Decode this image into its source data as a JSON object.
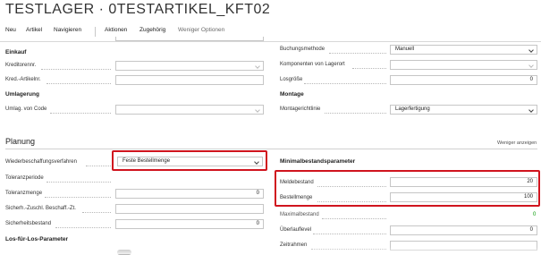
{
  "title": "TESTLAGER · 0TESTARTIKEL_KFT02",
  "menu": {
    "items": [
      "Neu",
      "Artikel",
      "Navigieren",
      "Aktionen",
      "Zugehörig",
      "Weniger Optionen"
    ]
  },
  "left_top": {
    "einkauf_heading": "Einkauf",
    "kreditorennr_label": "Kreditorennr.",
    "kreditorennr_value": "",
    "kred_artikelnr_label": "Kred.-Artikelnr.",
    "kred_artikelnr_value": "",
    "umlagerung_heading": "Umlagerung",
    "umlag_von_code_label": "Umlag. von Code",
    "umlag_von_code_value": ""
  },
  "right_top": {
    "buchungsmethode_label": "Buchungsmethode",
    "buchungsmethode_value": "Manuell",
    "komponenten_label": "Komponenten von Lagerort",
    "komponenten_value": "",
    "losgroesse_label": "Losgröße",
    "losgroesse_value": "0",
    "montage_heading": "Montage",
    "montagerichtlinie_label": "Montagerichtlinie",
    "montagerichtlinie_value": "Lagerfertigung"
  },
  "planung": {
    "title": "Planung",
    "show_less_link": "Weniger anzeigen",
    "wiederbeschaffung_label": "Wiederbeschaffungsverfahren",
    "wiederbeschaffung_value": "Feste Bestellmenge",
    "toleranzperiode_label": "Toleranzperiode",
    "toleranzmenge_label": "Toleranzmenge",
    "toleranzmenge_value": "0",
    "sicherh_zuschl_label": "Sicherh.-Zuschl. Beschaff.-Zt.",
    "sicherheitsbestand_label": "Sicherheitsbestand",
    "sicherheitsbestand_value": "0",
    "los_heading": "Los-für-Los-Parameter",
    "minimal_heading": "Minimalbestandsparameter",
    "meldebestand_label": "Meldebestand",
    "meldebestand_value": "20",
    "bestellmenge_label": "Bestellmenge",
    "bestellmenge_value": "100",
    "maximalbestand_label": "Maximalbestand",
    "maximalbestand_value": "0",
    "ueberlauflevel_label": "Überlauflevel",
    "ueberlauflevel_value": "0",
    "zeitrahmen_label": "Zeitrahmen",
    "zeitrahmen_value": ""
  },
  "colors": {
    "highlight": "#d0141e",
    "static_value": "#009900"
  }
}
